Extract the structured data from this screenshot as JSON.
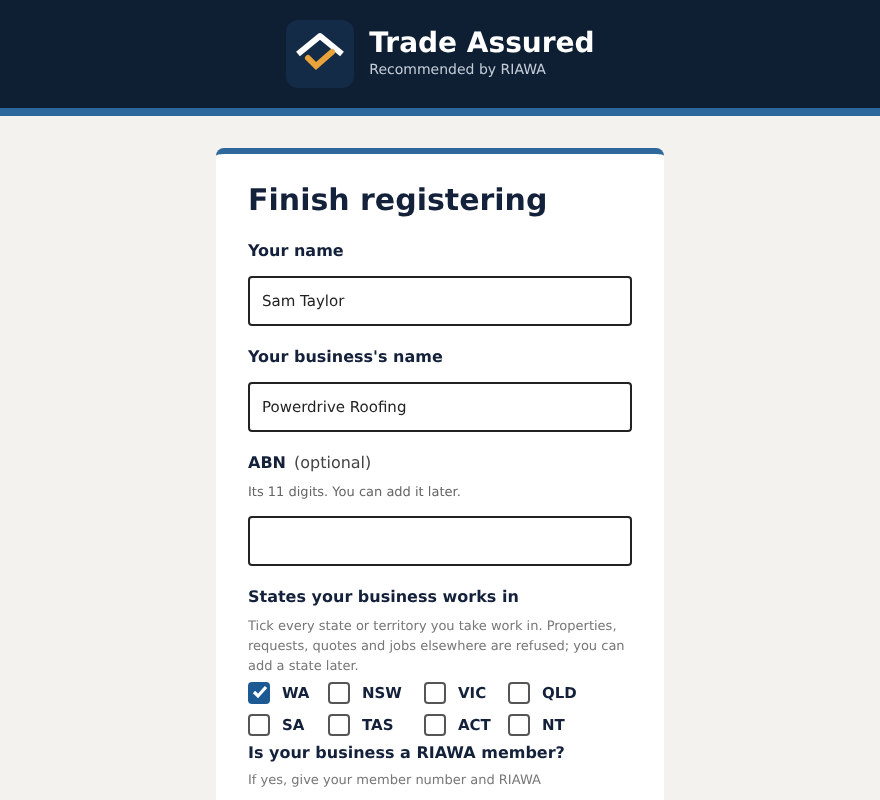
{
  "header": {
    "brand": "Trade Assured",
    "tagline": "Recommended by RIAWA"
  },
  "form": {
    "title": "Finish registering",
    "fields": [
      {
        "label": "Your name",
        "value": "Sam Taylor"
      },
      {
        "label": "Your business's name",
        "value": "Powerdrive Roofing"
      },
      {
        "label": "ABN",
        "optional": "(optional)",
        "hint": "Its 11 digits. You can add it later."
      }
    ],
    "states_section": {
      "label": "States your business works in",
      "hint": "Tick every state or territory you take work in. Properties, requests, quotes and jobs elsewhere are refused; you can add a state later.",
      "states": [
        {
          "label": "WA",
          "checked": true
        },
        {
          "label": "NSW",
          "checked": false
        },
        {
          "label": "VIC",
          "checked": false
        },
        {
          "label": "QLD",
          "checked": false
        },
        {
          "label": "SA",
          "checked": false
        },
        {
          "label": "TAS",
          "checked": false
        },
        {
          "label": "ACT",
          "checked": false
        },
        {
          "label": "NT",
          "checked": false
        }
      ]
    },
    "member_section": {
      "label": "Is your business a RIAWA member?",
      "hint": "If yes, give your member number and RIAWA"
    }
  }
}
